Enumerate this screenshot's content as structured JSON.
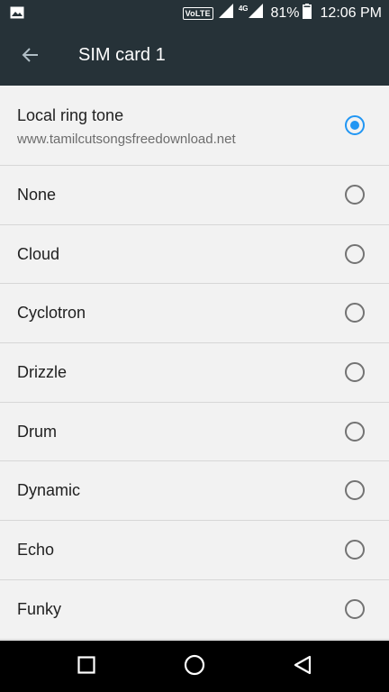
{
  "status_bar": {
    "volte": "VoLTE",
    "network": "4G",
    "battery_percent": "81%",
    "time": "12:06 PM",
    "icons": [
      "image-icon",
      "volte-icon",
      "signal-icon",
      "signal-4g-icon",
      "battery-icon"
    ]
  },
  "toolbar": {
    "title": "SIM card 1",
    "back_icon": "arrow-back-icon"
  },
  "ringtones": {
    "first": {
      "label": "Local ring tone",
      "subtitle": "www.tamilcutsongsfreedownload.net",
      "selected": true
    },
    "items": [
      {
        "label": "None",
        "selected": false
      },
      {
        "label": "Cloud",
        "selected": false
      },
      {
        "label": "Cyclotron",
        "selected": false
      },
      {
        "label": "Drizzle",
        "selected": false
      },
      {
        "label": "Drum",
        "selected": false
      },
      {
        "label": "Dynamic",
        "selected": false
      },
      {
        "label": "Echo",
        "selected": false
      },
      {
        "label": "Funky",
        "selected": false
      }
    ]
  },
  "nav_bar": {
    "icons": [
      "recents-icon",
      "home-icon",
      "back-triangle-icon"
    ]
  },
  "colors": {
    "bar": "#263238",
    "accent": "#2196f3",
    "background": "#f2f2f2"
  }
}
